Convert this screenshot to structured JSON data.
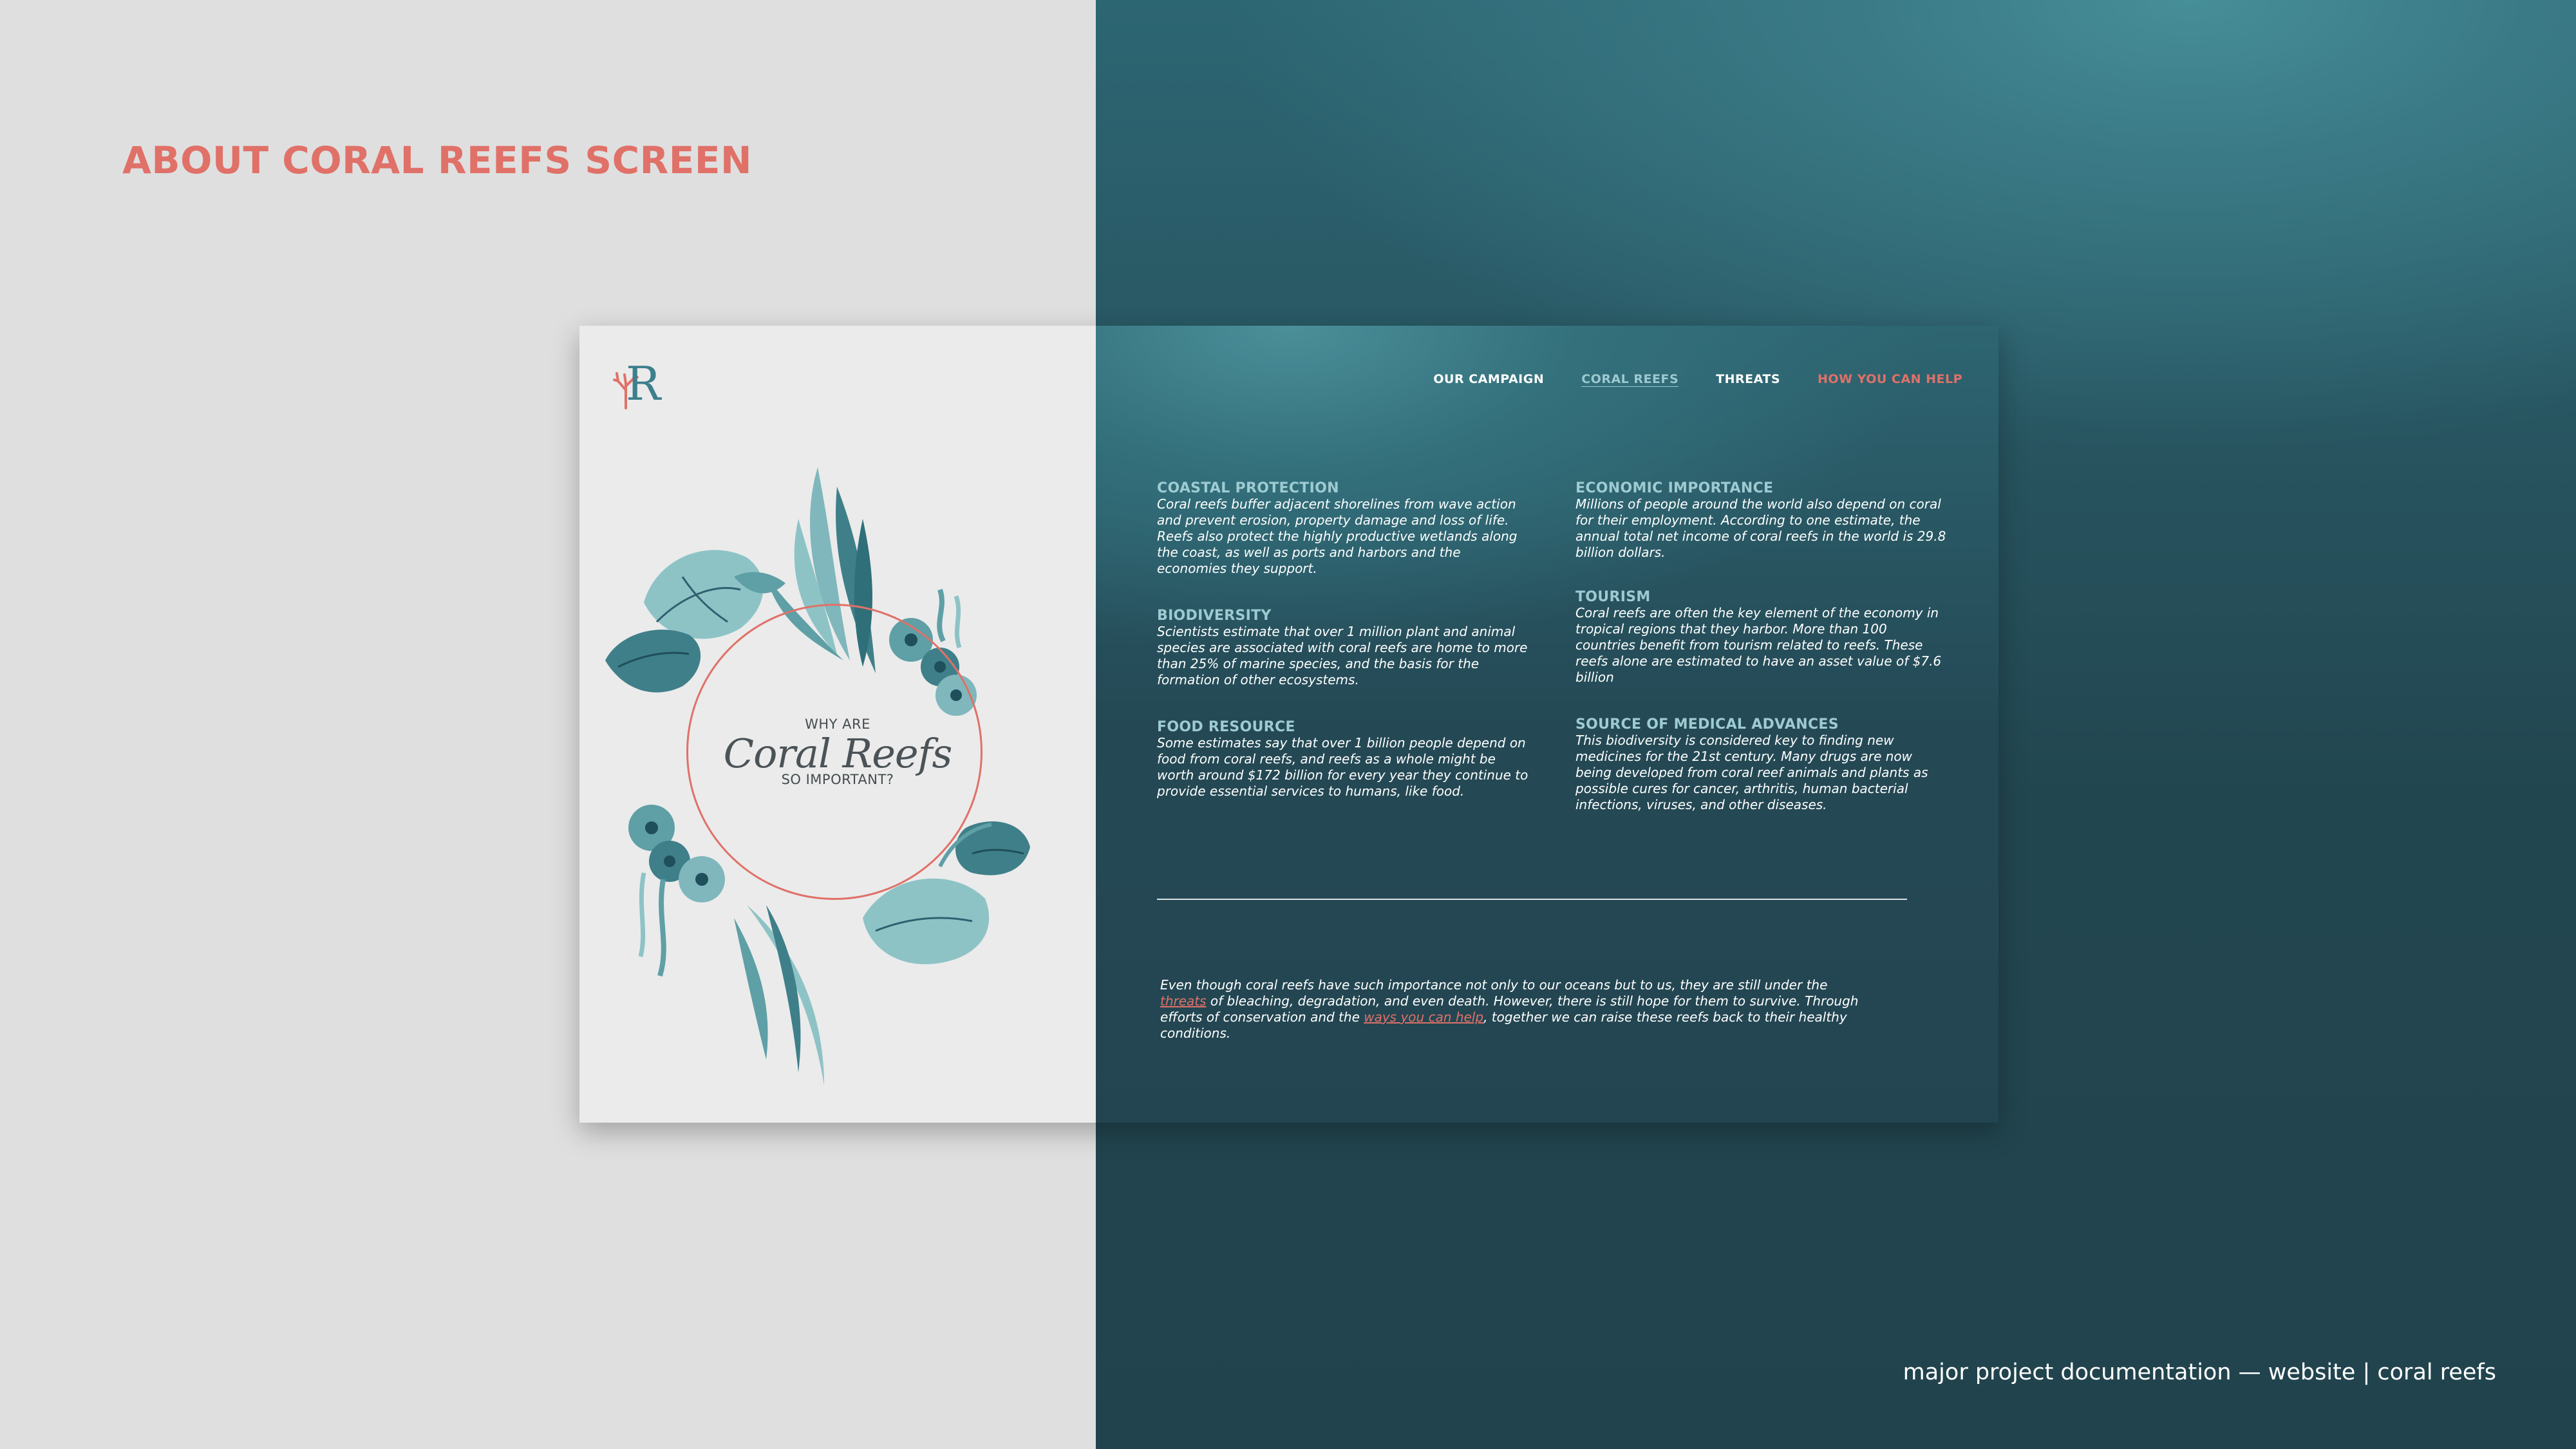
{
  "page": {
    "heading": "ABOUT CORAL REEFS SCREEN",
    "footer_caption": "major project documentation — website | coral reefs"
  },
  "colors": {
    "accent": "#e07168",
    "teal_dark": "#244955",
    "teal_light": "#9ecbd2",
    "panel_light": "#ebebeb"
  },
  "site": {
    "logo_icon": "coral-r-monogram",
    "nav": [
      {
        "label": "OUR CAMPAIGN",
        "state": "default"
      },
      {
        "label": "CORAL REEFS",
        "state": "active"
      },
      {
        "label": "THREATS",
        "state": "default"
      },
      {
        "label": "HOW YOU CAN HELP",
        "state": "highlight"
      }
    ],
    "hero": {
      "pre": "WHY ARE",
      "title": "Coral Reefs",
      "post": "SO IMPORTANT?"
    },
    "sections_left": [
      {
        "title": "COASTAL PROTECTION",
        "body": "Coral reefs buffer adjacent shorelines from wave action and prevent erosion, property damage and loss of life. Reefs also protect the highly productive wetlands along the coast, as well as ports and harbors and the economies they support."
      },
      {
        "title": "BIODIVERSITY",
        "body": "Scientists estimate that over 1 million plant and animal species are associated with coral reefs are home to more than 25% of marine species, and the basis for the formation of other ecosystems."
      },
      {
        "title": "FOOD RESOURCE",
        "body": "Some estimates say that over 1 billion people depend on food from coral reefs, and reefs as a whole might be worth around $172 billion for every year they continue to provide essential services to humans, like food."
      }
    ],
    "sections_right": [
      {
        "title": "ECONOMIC IMPORTANCE",
        "body": "Millions of people around the world also depend on coral for their employment. According to one estimate, the annual total net income of coral reefs in the world is 29.8 billion dollars."
      },
      {
        "title": "TOURISM",
        "body": "Coral reefs are often the key element of the economy in tropical regions that they harbor. More than 100 countries benefit from tourism related to reefs. These reefs alone are estimated to have an asset value of $7.6 billion"
      },
      {
        "title": "SOURCE OF MEDICAL ADVANCES",
        "body": "This biodiversity is considered key to finding new medicines for the 21st century. Many drugs are now being developed from coral reef animals and plants as possible cures for cancer, arthritis, human bacterial infections, viruses, and other diseases."
      }
    ],
    "closing": {
      "part1": "Even though coral reefs have such importance not only to our oceans but to us, they are still under the ",
      "link1": "threats",
      "part2": " of bleaching, degradation, and even death. However, there is still hope for them to survive. Through efforts of conservation and the ",
      "link2": "ways you can help",
      "part3": ", together we can raise these reefs back to their healthy conditions."
    }
  }
}
